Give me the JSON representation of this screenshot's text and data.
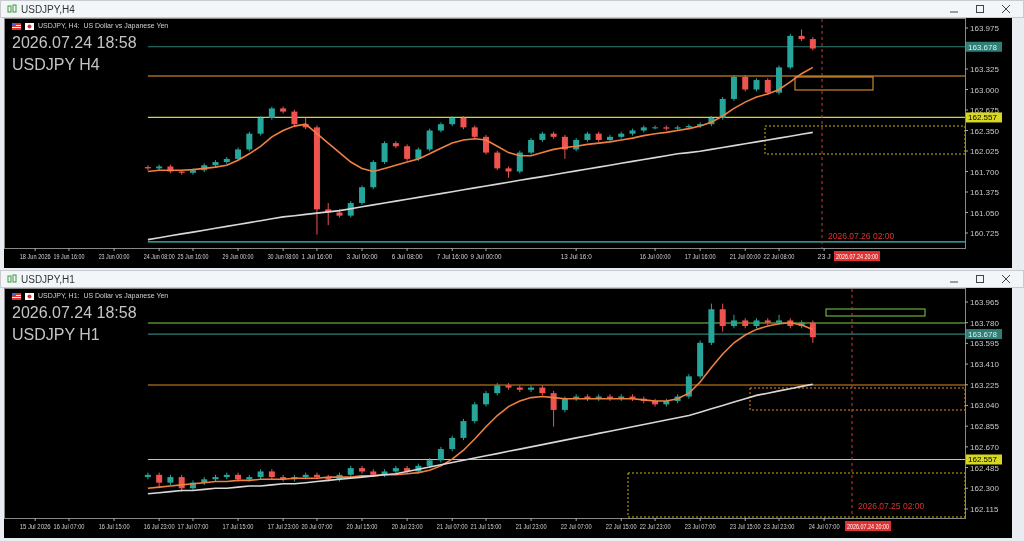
{
  "windows": [
    {
      "title": "USDJPY,H4",
      "chart_header": "USDJPY, H4:  US Dollar vs Japanese Yen",
      "overlay_lines": [
        "2026.07.24 18:58",
        "USDJPY H4"
      ],
      "marker_label": "2026.07.26 02:00",
      "time_tag": "2026.07.24 20:00",
      "chart_data": {
        "type": "candlestick",
        "ylim": [
          160.503,
          164.118
        ],
        "yticks": [
          {
            "value": 163.975,
            "label": "163.975"
          },
          {
            "value": 163.325,
            "label": "163.325"
          },
          {
            "value": 163.0,
            "label": "163.000"
          },
          {
            "value": 162.675,
            "label": "162.675"
          },
          {
            "value": 162.35,
            "label": "162.350"
          },
          {
            "value": 162.025,
            "label": "162.025"
          },
          {
            "value": 161.7,
            "label": "161.700"
          },
          {
            "value": 161.375,
            "label": "161.375"
          },
          {
            "value": 161.05,
            "label": "161.050"
          },
          {
            "value": 160.725,
            "label": "160.725"
          }
        ],
        "categories": [
          null,
          null,
          "18 Jun 2026",
          null,
          null,
          "19 Jun 16:00",
          null,
          null,
          null,
          "23 Jun 00:00",
          null,
          null,
          null,
          "24 Jun 08:00",
          null,
          null,
          "25 Jun 16:00",
          null,
          null,
          null,
          "29 Jun 00:00",
          null,
          null,
          null,
          "30 Jun 08:00",
          null,
          null,
          "1 Jul 16:00",
          null,
          null,
          null,
          "3 Jul 00:00",
          null,
          null,
          null,
          "6 Jul 08:00",
          null,
          null,
          null,
          "7 Jul 16:00",
          null,
          null,
          "9 Jul 00:00",
          null,
          null,
          null,
          null,
          null,
          null,
          null,
          "13 Jul 16:0",
          null,
          null,
          null,
          null,
          null,
          null,
          "16 Jul 00:00",
          null,
          null,
          null,
          "17 Jul 16:00",
          null,
          null,
          null,
          "21 Jul 00:00",
          null,
          null,
          "22 Jul 08:00",
          null,
          null,
          null,
          "23 J",
          null,
          null,
          null,
          null,
          null,
          null,
          null,
          null,
          null,
          null,
          null,
          null
        ],
        "ohlc": [
          null,
          null,
          null,
          null,
          null,
          null,
          null,
          null,
          null,
          null,
          null,
          null,
          [
            161.77,
            161.8,
            161.72,
            161.75
          ],
          [
            161.75,
            161.81,
            161.72,
            161.78
          ],
          [
            161.78,
            161.81,
            161.67,
            161.7
          ],
          [
            161.7,
            161.73,
            161.65,
            161.68
          ],
          [
            161.68,
            161.75,
            161.65,
            161.72
          ],
          [
            161.72,
            161.83,
            161.69,
            161.8
          ],
          [
            161.8,
            161.88,
            161.77,
            161.85
          ],
          [
            161.85,
            161.93,
            161.82,
            161.9
          ],
          [
            161.9,
            162.08,
            161.87,
            162.05
          ],
          [
            162.05,
            162.33,
            162.02,
            162.3
          ],
          [
            162.3,
            162.58,
            162.27,
            162.55
          ],
          [
            162.55,
            162.73,
            162.52,
            162.7
          ],
          [
            162.7,
            162.73,
            162.62,
            162.65
          ],
          [
            162.65,
            162.68,
            162.42,
            162.45
          ],
          [
            162.45,
            162.55,
            162.37,
            162.4
          ],
          [
            162.4,
            162.43,
            160.7,
            161.1
          ],
          [
            161.1,
            161.2,
            160.85,
            161.05
          ],
          [
            161.05,
            161.1,
            160.97,
            161.0
          ],
          [
            161.0,
            161.23,
            160.97,
            161.2
          ],
          [
            161.2,
            161.48,
            161.17,
            161.45
          ],
          [
            161.45,
            161.88,
            161.42,
            161.85
          ],
          [
            161.85,
            162.18,
            161.82,
            162.15
          ],
          [
            162.15,
            162.18,
            162.07,
            162.1
          ],
          [
            162.1,
            162.13,
            161.87,
            161.9
          ],
          [
            161.9,
            162.08,
            161.87,
            162.05
          ],
          [
            162.05,
            162.38,
            162.02,
            162.35
          ],
          [
            162.35,
            162.48,
            162.32,
            162.45
          ],
          [
            162.45,
            162.58,
            162.42,
            162.55
          ],
          [
            162.55,
            162.58,
            162.37,
            162.4
          ],
          [
            162.4,
            162.43,
            162.22,
            162.25
          ],
          [
            162.25,
            162.28,
            161.97,
            162.0
          ],
          [
            162.0,
            162.03,
            161.72,
            161.75
          ],
          [
            161.75,
            161.78,
            161.6,
            161.7
          ],
          [
            161.7,
            162.03,
            161.67,
            162.0
          ],
          [
            162.0,
            162.23,
            161.97,
            162.2
          ],
          [
            162.2,
            162.33,
            162.17,
            162.3
          ],
          [
            162.3,
            162.33,
            162.22,
            162.25
          ],
          [
            162.25,
            162.28,
            161.9,
            162.05
          ],
          [
            162.05,
            162.23,
            162.02,
            162.2
          ],
          [
            162.2,
            162.33,
            162.17,
            162.3
          ],
          [
            162.3,
            162.33,
            162.17,
            162.2
          ],
          [
            162.2,
            162.28,
            162.17,
            162.25
          ],
          [
            162.25,
            162.33,
            162.22,
            162.3
          ],
          [
            162.3,
            162.38,
            162.27,
            162.35
          ],
          [
            162.35,
            162.43,
            162.32,
            162.4
          ],
          [
            162.4,
            162.43,
            162.37,
            162.4
          ],
          [
            162.4,
            162.43,
            162.35,
            162.38
          ],
          [
            162.38,
            162.43,
            162.35,
            162.4
          ],
          [
            162.4,
            162.45,
            162.37,
            162.42
          ],
          [
            162.42,
            162.48,
            162.39,
            162.45
          ],
          [
            162.45,
            162.58,
            162.42,
            162.55
          ],
          [
            162.55,
            162.88,
            162.52,
            162.85
          ],
          [
            162.85,
            163.23,
            162.82,
            163.2
          ],
          [
            163.2,
            163.23,
            162.97,
            163.0
          ],
          [
            163.0,
            163.18,
            162.97,
            163.15
          ],
          [
            163.15,
            163.18,
            162.92,
            162.95
          ],
          [
            162.95,
            163.38,
            162.92,
            163.35
          ],
          [
            163.35,
            163.88,
            163.32,
            163.85
          ],
          [
            163.85,
            163.95,
            163.77,
            163.8
          ],
          [
            163.8,
            163.83,
            163.62,
            163.65
          ],
          null,
          null,
          null,
          null,
          null,
          null,
          null,
          null,
          null,
          null,
          null,
          null,
          null
        ],
        "series": [
          {
            "type": "line",
            "color": "#f08040",
            "values": [
              null,
              null,
              null,
              null,
              null,
              null,
              null,
              null,
              null,
              null,
              null,
              null,
              161.7,
              161.72,
              161.72,
              161.72,
              161.73,
              161.75,
              161.77,
              161.8,
              161.88,
              161.98,
              162.1,
              162.25,
              162.35,
              162.42,
              162.45,
              162.3,
              162.15,
              162.0,
              161.85,
              161.75,
              161.7,
              161.75,
              161.8,
              161.85,
              161.9,
              161.98,
              162.07,
              162.15,
              162.2,
              162.22,
              162.2,
              162.1,
              162.0,
              161.95,
              161.95,
              162.0,
              162.05,
              162.08,
              162.1,
              162.13,
              162.15,
              162.17,
              162.2,
              162.23,
              162.27,
              162.3,
              162.32,
              162.35,
              162.38,
              162.42,
              162.48,
              162.58,
              162.7,
              162.8,
              162.88,
              162.93,
              163.0,
              163.12,
              163.25,
              163.35,
              null,
              null,
              null,
              null,
              null,
              null,
              null,
              null,
              null,
              null,
              null,
              null,
              null
            ]
          },
          {
            "type": "line",
            "color": "#d8d8d8",
            "values": [
              null,
              null,
              null,
              null,
              null,
              null,
              null,
              null,
              null,
              null,
              null,
              null,
              160.62,
              160.65,
              160.68,
              160.71,
              160.74,
              160.77,
              160.8,
              160.83,
              160.86,
              160.89,
              160.92,
              160.95,
              160.98,
              161.0,
              161.02,
              161.04,
              161.06,
              161.08,
              161.11,
              161.14,
              161.17,
              161.2,
              161.23,
              161.26,
              161.29,
              161.32,
              161.35,
              161.38,
              161.41,
              161.44,
              161.47,
              161.5,
              161.53,
              161.56,
              161.59,
              161.62,
              161.65,
              161.68,
              161.71,
              161.74,
              161.77,
              161.8,
              161.83,
              161.86,
              161.89,
              161.92,
              161.95,
              161.98,
              162.0,
              162.02,
              162.05,
              162.08,
              162.11,
              162.14,
              162.17,
              162.2,
              162.23,
              162.26,
              162.29,
              162.32,
              null,
              null,
              null,
              null,
              null,
              null,
              null,
              null,
              null,
              null,
              null,
              null,
              null
            ]
          }
        ],
        "ref_lines": [
          {
            "axis": "y",
            "value": 163.678,
            "color": "#2f7f76",
            "label": "163.678"
          },
          {
            "axis": "y",
            "value": 163.214,
            "color": "#f0a030"
          },
          {
            "axis": "y",
            "value": 162.557,
            "color": "#d8d820",
            "label": "162.557"
          },
          {
            "axis": "y",
            "value": 160.583,
            "color": "#40c0c0"
          }
        ]
      }
    },
    {
      "title": "USDJPY,H1",
      "chart_header": "USDJPY, H1:  US Dollar vs Japanese Yen",
      "overlay_lines": [
        "2026.07.24 18:58",
        "USDJPY H1"
      ],
      "marker_label": "2026.07.25 02:00",
      "time_tag": "2026.07.24 20:00",
      "chart_data": {
        "type": "candlestick",
        "ylim": [
          162.043,
          164.081
        ],
        "yticks": [
          {
            "value": 163.965,
            "label": "163.965"
          },
          {
            "value": 163.78,
            "label": "163.780"
          },
          {
            "value": 163.595,
            "label": "163.595"
          },
          {
            "value": 163.41,
            "label": "163.410"
          },
          {
            "value": 163.225,
            "label": "163.225"
          },
          {
            "value": 163.04,
            "label": "163.040"
          },
          {
            "value": 162.855,
            "label": "162.855"
          },
          {
            "value": 162.67,
            "label": "162.670"
          },
          {
            "value": 162.485,
            "label": "162.485"
          },
          {
            "value": 162.3,
            "label": "162.300"
          },
          {
            "value": 162.115,
            "label": "162.115"
          }
        ],
        "categories": [
          null,
          null,
          "15 Jul 2026",
          null,
          null,
          "16 Jul 07:00",
          null,
          null,
          null,
          "16 Jul 15:00",
          null,
          null,
          null,
          "16 Jul 23:00",
          null,
          null,
          "17 Jul 07:00",
          null,
          null,
          null,
          "17 Jul 15:00",
          null,
          null,
          null,
          "17 Jul 23:00",
          null,
          null,
          "20 Jul 07:00",
          null,
          null,
          null,
          "20 Jul 15:00",
          null,
          null,
          null,
          "20 Jul 23:00",
          null,
          null,
          null,
          "21 Jul 07:00",
          null,
          null,
          "21 Jul 15:00",
          null,
          null,
          null,
          "21 Jul 23:00",
          null,
          null,
          null,
          "22 Jul 07:00",
          null,
          null,
          null,
          "22 Jul 15:00",
          null,
          null,
          "22 Jul 23:00",
          null,
          null,
          null,
          "23 Jul 07:00",
          null,
          null,
          null,
          "23 Jul 15:00",
          null,
          null,
          "23 Jul 23:00",
          null,
          null,
          null,
          "24 Jul 07:00",
          null,
          null,
          null,
          null,
          null,
          null,
          null,
          null,
          null,
          null,
          null,
          null
        ],
        "ohlc": [
          null,
          null,
          null,
          null,
          null,
          null,
          null,
          null,
          null,
          null,
          null,
          null,
          [
            162.4,
            162.44,
            162.38,
            162.42
          ],
          [
            162.42,
            162.44,
            162.3,
            162.35
          ],
          [
            162.35,
            162.42,
            162.33,
            162.4
          ],
          [
            162.4,
            162.42,
            162.27,
            162.3
          ],
          [
            162.3,
            162.37,
            162.28,
            162.35
          ],
          [
            162.35,
            162.4,
            162.33,
            162.38
          ],
          [
            162.38,
            162.42,
            162.36,
            162.4
          ],
          [
            162.4,
            162.44,
            162.38,
            162.42
          ],
          [
            162.42,
            162.44,
            162.36,
            162.38
          ],
          [
            162.38,
            162.42,
            162.36,
            162.4
          ],
          [
            162.4,
            162.47,
            162.38,
            162.45
          ],
          [
            162.45,
            162.47,
            162.38,
            162.4
          ],
          [
            162.4,
            162.42,
            162.36,
            162.38
          ],
          [
            162.38,
            162.42,
            162.36,
            162.4
          ],
          [
            162.4,
            162.44,
            162.38,
            162.42
          ],
          [
            162.42,
            162.44,
            162.38,
            162.4
          ],
          [
            162.4,
            162.42,
            162.36,
            162.38
          ],
          [
            162.38,
            162.44,
            162.36,
            162.42
          ],
          [
            162.42,
            162.5,
            162.4,
            162.48
          ],
          [
            162.48,
            162.5,
            162.43,
            162.45
          ],
          [
            162.45,
            162.47,
            162.4,
            162.42
          ],
          [
            162.42,
            162.47,
            162.4,
            162.45
          ],
          [
            162.45,
            162.5,
            162.43,
            162.48
          ],
          [
            162.48,
            162.5,
            162.43,
            162.45
          ],
          [
            162.45,
            162.52,
            162.43,
            162.5
          ],
          [
            162.5,
            162.57,
            162.48,
            162.55
          ],
          [
            162.55,
            162.67,
            162.53,
            162.65
          ],
          [
            162.65,
            162.77,
            162.63,
            162.75
          ],
          [
            162.75,
            162.92,
            162.73,
            162.9
          ],
          [
            162.9,
            163.07,
            162.88,
            163.05
          ],
          [
            163.05,
            163.17,
            163.03,
            163.15
          ],
          [
            163.15,
            163.24,
            163.13,
            163.22
          ],
          [
            163.22,
            163.24,
            163.18,
            163.2
          ],
          [
            163.2,
            163.22,
            163.16,
            163.18
          ],
          [
            163.18,
            163.22,
            163.16,
            163.2
          ],
          [
            163.2,
            163.22,
            163.13,
            163.15
          ],
          [
            163.15,
            163.17,
            162.85,
            163.0
          ],
          [
            163.0,
            163.12,
            162.98,
            163.1
          ],
          [
            163.1,
            163.14,
            163.08,
            163.12
          ],
          [
            163.12,
            163.14,
            163.08,
            163.1
          ],
          [
            163.1,
            163.14,
            163.08,
            163.12
          ],
          [
            163.12,
            163.14,
            163.08,
            163.1
          ],
          [
            163.1,
            163.14,
            163.08,
            163.12
          ],
          [
            163.12,
            163.14,
            163.08,
            163.1
          ],
          [
            163.1,
            163.12,
            163.06,
            163.08
          ],
          [
            163.08,
            163.1,
            163.03,
            163.05
          ],
          [
            163.05,
            163.1,
            163.03,
            163.08
          ],
          [
            163.08,
            163.14,
            163.06,
            163.12
          ],
          [
            163.12,
            163.32,
            163.1,
            163.3
          ],
          [
            163.3,
            163.62,
            163.28,
            163.6
          ],
          [
            163.6,
            163.95,
            163.58,
            163.9
          ],
          [
            163.9,
            163.95,
            163.7,
            163.75
          ],
          [
            163.75,
            163.85,
            163.73,
            163.8
          ],
          [
            163.8,
            163.82,
            163.73,
            163.75
          ],
          [
            163.75,
            163.82,
            163.73,
            163.8
          ],
          [
            163.8,
            163.82,
            163.76,
            163.78
          ],
          [
            163.78,
            163.85,
            163.76,
            163.8
          ],
          [
            163.8,
            163.82,
            163.73,
            163.75
          ],
          [
            163.75,
            163.8,
            163.73,
            163.78
          ],
          [
            163.78,
            163.8,
            163.6,
            163.65
          ],
          null,
          null,
          null,
          null,
          null,
          null,
          null,
          null,
          null,
          null,
          null,
          null,
          null
        ],
        "series": [
          {
            "type": "line",
            "color": "#f08040",
            "values": [
              null,
              null,
              null,
              null,
              null,
              null,
              null,
              null,
              null,
              null,
              null,
              null,
              162.3,
              162.31,
              162.32,
              162.33,
              162.34,
              162.35,
              162.36,
              162.36,
              162.37,
              162.37,
              162.38,
              162.38,
              162.38,
              162.39,
              162.39,
              162.39,
              162.4,
              162.4,
              162.4,
              162.41,
              162.41,
              162.42,
              162.42,
              162.43,
              162.44,
              162.46,
              162.5,
              162.56,
              162.64,
              162.74,
              162.85,
              162.95,
              163.03,
              163.08,
              163.11,
              163.12,
              163.11,
              163.1,
              163.1,
              163.1,
              163.1,
              163.1,
              163.1,
              163.1,
              163.09,
              163.08,
              163.08,
              163.1,
              163.15,
              163.25,
              163.38,
              163.5,
              163.6,
              163.67,
              163.72,
              163.75,
              163.77,
              163.78,
              163.76,
              163.72,
              null,
              null,
              null,
              null,
              null,
              null,
              null,
              null,
              null,
              null,
              null,
              null,
              null
            ]
          },
          {
            "type": "line",
            "color": "#d8d8d8",
            "values": [
              null,
              null,
              null,
              null,
              null,
              null,
              null,
              null,
              null,
              null,
              null,
              null,
              162.25,
              162.26,
              162.27,
              162.28,
              162.28,
              162.29,
              162.3,
              162.3,
              162.31,
              162.32,
              162.32,
              162.33,
              162.34,
              162.34,
              162.35,
              162.36,
              162.37,
              162.38,
              162.39,
              162.4,
              162.41,
              162.42,
              162.43,
              162.45,
              162.47,
              162.49,
              162.51,
              162.53,
              162.55,
              162.57,
              162.59,
              162.61,
              162.63,
              162.65,
              162.67,
              162.69,
              162.71,
              162.73,
              162.75,
              162.77,
              162.79,
              162.81,
              162.83,
              162.85,
              162.87,
              162.89,
              162.91,
              162.93,
              162.95,
              162.98,
              163.01,
              163.04,
              163.07,
              163.1,
              163.13,
              163.15,
              163.17,
              163.19,
              163.21,
              163.23,
              null,
              null,
              null,
              null,
              null,
              null,
              null,
              null,
              null,
              null,
              null,
              null,
              null
            ]
          }
        ],
        "ref_lines": [
          {
            "axis": "y",
            "value": 163.777,
            "color": "#80d040"
          },
          {
            "axis": "y",
            "value": 163.678,
            "color": "#2f7f76",
            "label": "163.678"
          },
          {
            "axis": "y",
            "value": 163.223,
            "color": "#e08a20"
          },
          {
            "axis": "y",
            "value": 162.557,
            "color": "#d8d820",
            "label": "162.557"
          }
        ]
      }
    }
  ]
}
